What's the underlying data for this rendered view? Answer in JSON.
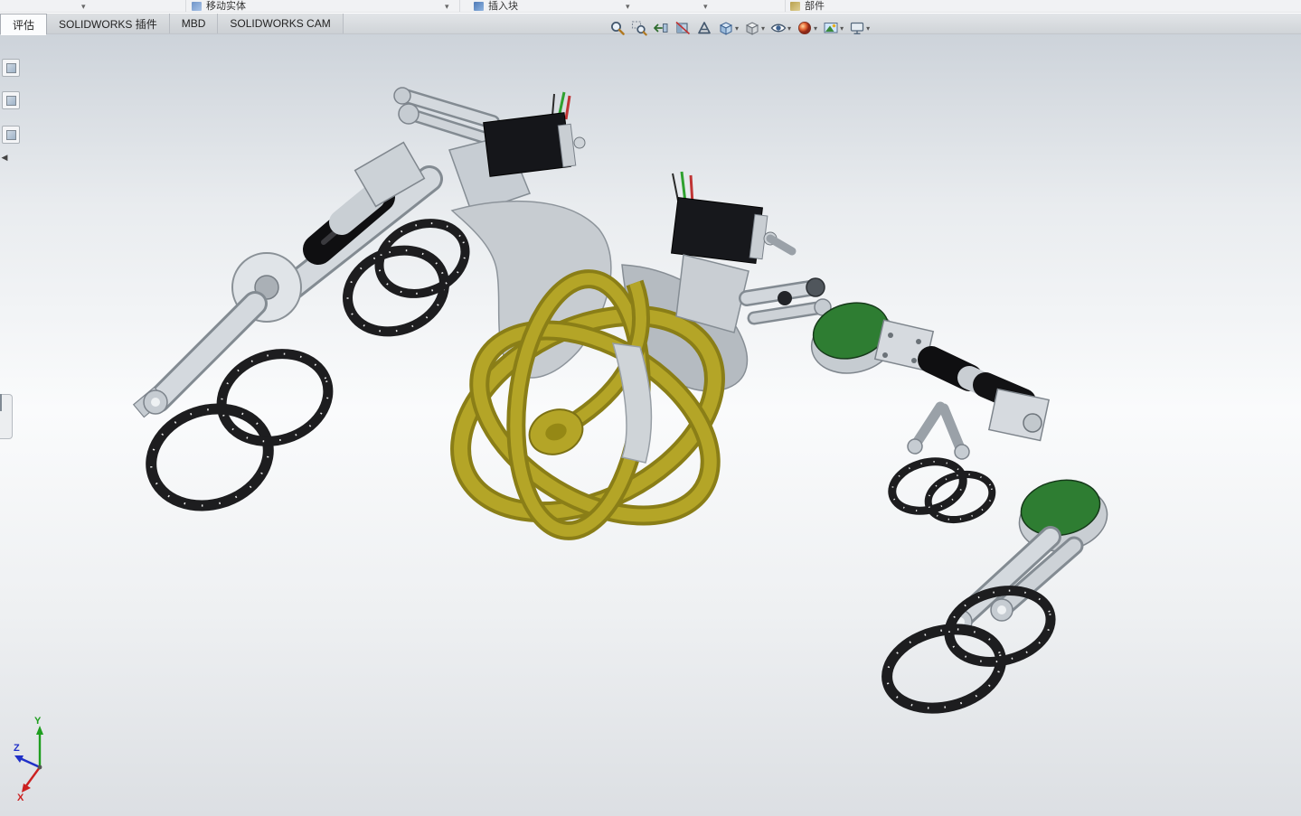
{
  "app": {
    "name": "SOLIDWORKS"
  },
  "top_toolbar": {
    "labels": [
      "移动实体",
      "插入块",
      "部件"
    ]
  },
  "tab_bar": {
    "active_index": 0,
    "tabs": [
      {
        "label": "评估"
      },
      {
        "label": "SOLIDWORKS 插件"
      },
      {
        "label": "MBD"
      },
      {
        "label": "SOLIDWORKS CAM"
      }
    ]
  },
  "view_toolbar": {
    "icons": [
      {
        "name": "zoom-to-fit",
        "dropdown": false
      },
      {
        "name": "zoom-to-area",
        "dropdown": false
      },
      {
        "name": "previous-view",
        "dropdown": false
      },
      {
        "name": "section-view",
        "dropdown": false
      },
      {
        "name": "dynamic-annotation-views",
        "dropdown": false
      },
      {
        "name": "view-orientation",
        "dropdown": true
      },
      {
        "name": "display-style",
        "dropdown": true
      },
      {
        "name": "hide-show-items",
        "dropdown": true
      },
      {
        "name": "edit-appearance",
        "dropdown": true
      },
      {
        "name": "apply-scene",
        "dropdown": true
      },
      {
        "name": "view-settings",
        "dropdown": true
      }
    ]
  },
  "triad": {
    "x_label": "X",
    "y_label": "Y",
    "z_label": "Z",
    "x_color": "#cc2020",
    "y_color": "#1f9e1f",
    "z_color": "#2030c8"
  },
  "model_colors": {
    "metal": "#d3d8dd",
    "metal_edge": "#8a9199",
    "motor_black": "#131316",
    "hoop_black": "#1d1d1f",
    "wheel_yellow": "#b2a327",
    "wheel_yellow_dark": "#857a18",
    "disc_green": "#2e7d32",
    "body_gray": "#c7ccd1"
  }
}
